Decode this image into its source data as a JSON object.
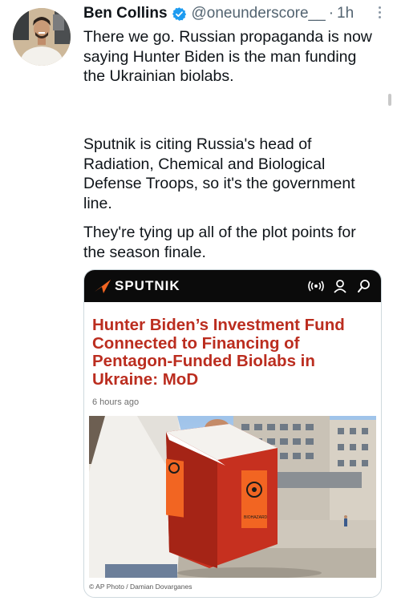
{
  "tweet": {
    "author_name": "Ben Collins",
    "handle": "@oneunderscore__",
    "separator": "·",
    "time": "1h",
    "paragraphs": [
      "There we go. Russian propaganda is now saying Hunter Biden is the man funding the Ukrainian biolabs.",
      "Sputnik is citing Russia's head of Radiation, Chemical and Biological Defense Troops, so it's the government line.",
      "They're tying up all of the plot points for the season finale."
    ]
  },
  "card": {
    "brand": "SPUTNIK",
    "headline": "Hunter Biden’s Investment Fund Connected to Financing of Pentagon-Funded Biolabs in Ukraine: MoD",
    "time_ago": "6 hours ago",
    "photo_credit": "© AP Photo / Damian Dovarganes",
    "cooler_label": "BIOHAZARD"
  },
  "colors": {
    "verified": "#1d9bf0",
    "headline": "#bb2d1f",
    "sputnik_orange": "#f26522",
    "cooler_red": "#c6301f"
  },
  "icons": [
    "verified-badge-icon",
    "more-options-icon",
    "sputnik-logo-icon",
    "radio-icon",
    "user-icon",
    "search-icon"
  ]
}
